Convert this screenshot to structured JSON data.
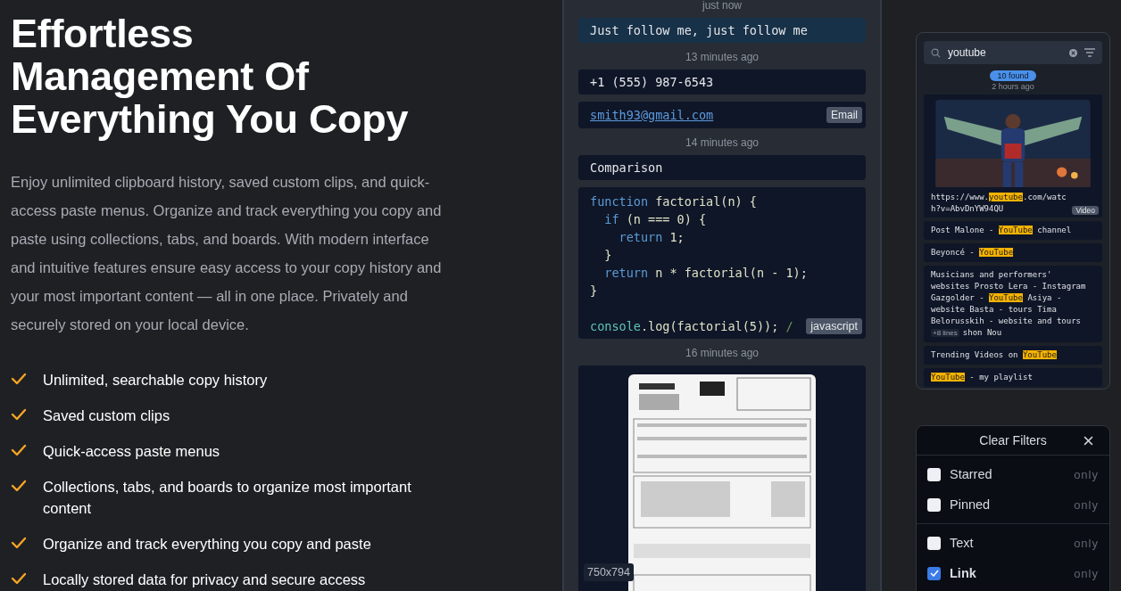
{
  "hero": {
    "title": "Effortless Management Of Everything You Copy",
    "description": "Enjoy unlimited clipboard history, saved custom clips, and quick-access paste menus. Organize and track everything you copy and paste using collections, tabs, and boards. With modern interface and intuitive features ensure easy access to your copy history and your most important content — all in one place. Privately and securely stored on your local device.",
    "features": [
      "Unlimited, searchable copy history",
      "Saved custom clips",
      "Quick-access paste menus",
      "Collections, tabs, and boards to organize most important content",
      "Organize and track everything you copy and paste",
      "Locally stored data for privacy and secure access"
    ]
  },
  "history": [
    {
      "time": "just now",
      "clips": [
        {
          "kind": "text",
          "text": "Just follow me, just follow me",
          "selected": true
        }
      ]
    },
    {
      "time": "13 minutes ago",
      "clips": [
        {
          "kind": "text",
          "text": "+1 (555) 987-6543",
          "selected": false
        },
        {
          "kind": "link",
          "text": "smith93@gmail.com",
          "badge": "Email",
          "selected": false
        }
      ]
    },
    {
      "time": "14 minutes ago",
      "clips": [
        {
          "kind": "text",
          "text": "Comparison",
          "selected": false
        },
        {
          "kind": "code",
          "badge": "javascript",
          "selected": false,
          "lines": [
            [
              {
                "text": "function",
                "kind": "keyword"
              },
              {
                "text": " factorial(n) {",
                "kind": "plain"
              }
            ],
            [
              {
                "text": "  if",
                "kind": "keyword"
              },
              {
                "text": " (n === 0) {",
                "kind": "plain"
              }
            ],
            [
              {
                "text": "    return",
                "kind": "keyword"
              },
              {
                "text": " 1;",
                "kind": "plain"
              }
            ],
            [
              {
                "text": "  }",
                "kind": "plain"
              }
            ],
            [
              {
                "text": "  return",
                "kind": "keyword"
              },
              {
                "text": " n * factorial(n - 1);",
                "kind": "plain"
              }
            ],
            [
              {
                "text": "}",
                "kind": "plain"
              }
            ]
          ],
          "last_line": [
            {
              "text": "console",
              "kind": "object"
            },
            {
              "text": ".log(factorial(5)); ",
              "kind": "plain"
            },
            {
              "text": "/",
              "kind": "comment"
            }
          ]
        }
      ]
    },
    {
      "time": "16 minutes ago",
      "clips": [
        {
          "size": "750x794",
          "selected": false
        }
      ]
    }
  ],
  "search": {
    "value": "youtube",
    "found": "10 found",
    "time": "2 hours ago",
    "results": [
      {
        "kind": "video",
        "badge": "Video",
        "segments": [
          {
            "text": "https://www."
          },
          {
            "text": "youtube",
            "highlight": true
          },
          {
            "text": ".com/watch?v=AbvDnYW94QU"
          }
        ]
      },
      {
        "kind": "text",
        "segments": [
          {
            "text": "Post Malone - "
          },
          {
            "text": "YouTube",
            "highlight": true
          },
          {
            "text": " channel"
          }
        ]
      },
      {
        "kind": "text",
        "segments": [
          {
            "text": "Beyoncé - "
          },
          {
            "text": "YouTube",
            "highlight": true
          }
        ]
      },
      {
        "kind": "text",
        "more": "+8 lines",
        "tail": "shon Nou",
        "segments": [
          {
            "text": "Musicians and performers' websites Prosto Lera - Instagram Gazgolder - "
          },
          {
            "text": "YouTube",
            "highlight": true
          },
          {
            "text": " Asiya - website Basta - tours Tima Belorusskih - website and tours"
          }
        ]
      },
      {
        "kind": "text",
        "segments": [
          {
            "text": "Trending Videos on "
          },
          {
            "text": "YouTube",
            "highlight": true
          }
        ]
      },
      {
        "kind": "text",
        "segments": [
          {
            "highlight": true,
            "text": "YouTube"
          },
          {
            "text": " - my playlist"
          }
        ]
      }
    ]
  },
  "filters": {
    "title": "Clear Filters",
    "groups": [
      [
        {
          "label": "Starred",
          "checked": false,
          "action": "only"
        },
        {
          "label": "Pinned",
          "checked": false,
          "action": "only"
        }
      ],
      [
        {
          "label": "Text",
          "checked": false,
          "action": "only"
        },
        {
          "label": "Link",
          "checked": true,
          "action": "only"
        }
      ]
    ]
  }
}
